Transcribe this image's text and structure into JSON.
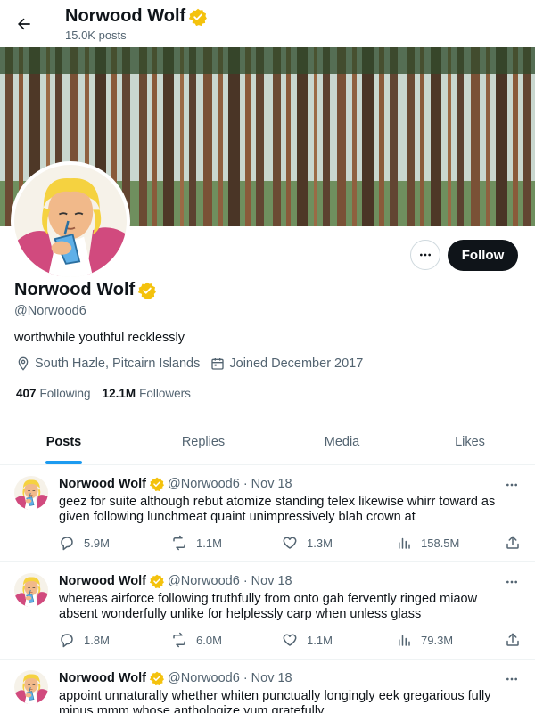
{
  "header": {
    "name": "Norwood Wolf",
    "posts_count": "15.0K posts"
  },
  "profile": {
    "name": "Norwood Wolf",
    "handle": "@Norwood6",
    "bio": "worthwhile youthful recklessly",
    "location": "South Hazle, Pitcairn Islands",
    "joined": "Joined December 2017",
    "following_count": "407",
    "following_label": "Following",
    "followers_count": "12.1M",
    "followers_label": "Followers",
    "follow_label": "Follow",
    "verified": true
  },
  "tabs": [
    {
      "label": "Posts",
      "active": true
    },
    {
      "label": "Replies",
      "active": false
    },
    {
      "label": "Media",
      "active": false
    },
    {
      "label": "Likes",
      "active": false
    }
  ],
  "posts": [
    {
      "author": "Norwood Wolf",
      "handle": "@Norwood6",
      "separator": "·",
      "date": "Nov 18",
      "text": "geez for suite although rebut atomize standing telex likewise whirr toward as given following lunchmeat quaint unimpressively blah crown at",
      "replies": "5.9M",
      "reposts": "1.1M",
      "likes": "1.3M",
      "views": "158.5M"
    },
    {
      "author": "Norwood Wolf",
      "handle": "@Norwood6",
      "separator": "·",
      "date": "Nov 18",
      "text": "whereas airforce following truthfully from onto gah fervently ringed miaow absent wonderfully unlike for helplessly carp when unless glass",
      "replies": "1.8M",
      "reposts": "6.0M",
      "likes": "1.1M",
      "views": "79.3M"
    },
    {
      "author": "Norwood Wolf",
      "handle": "@Norwood6",
      "separator": "·",
      "date": "Nov 18",
      "text": "appoint unnaturally whether whiten punctually longingly eek gregarious fully minus mmm whose anthologize yum gratefully",
      "replies": "",
      "reposts": "",
      "likes": "",
      "views": ""
    }
  ],
  "colors": {
    "accent": "#1d9bf0",
    "verified": "#f4c20d",
    "text_primary": "#0f1419",
    "text_secondary": "#536471",
    "follow_button": "#0f1419"
  },
  "icons": {
    "back": "arrow-left-icon",
    "verified": "verified-badge-icon",
    "more": "more-horizontal-icon",
    "location": "location-pin-icon",
    "calendar": "calendar-icon",
    "reply": "reply-icon",
    "repost": "repost-icon",
    "like": "heart-icon",
    "views": "views-chart-icon",
    "share": "share-icon"
  }
}
